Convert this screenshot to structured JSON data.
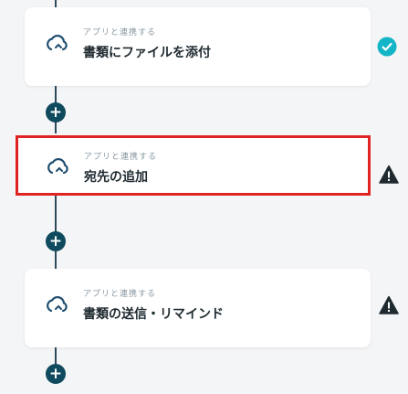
{
  "flow": {
    "steps": [
      {
        "sub_label": "アプリと連携する",
        "title": "書類にファイルを添付",
        "status": "completed",
        "status_icon": "check-circle-icon",
        "status_color": "#13b5c7"
      },
      {
        "sub_label": "アプリと連携する",
        "title": "宛先の追加",
        "status": "warning",
        "status_icon": "warning-icon",
        "status_color": "#1f2a30",
        "highlighted": true
      },
      {
        "sub_label": "アプリと連携する",
        "title": "書類の送信・リマインド",
        "status": "warning",
        "status_icon": "warning-icon",
        "status_color": "#1f2a30"
      }
    ],
    "add_button_symbol": "+",
    "colors": {
      "connector": "#2c4a5c",
      "add_button": "#0f4a5e",
      "highlight_border": "#e02424",
      "app_icon": "#1f4d6e"
    }
  }
}
